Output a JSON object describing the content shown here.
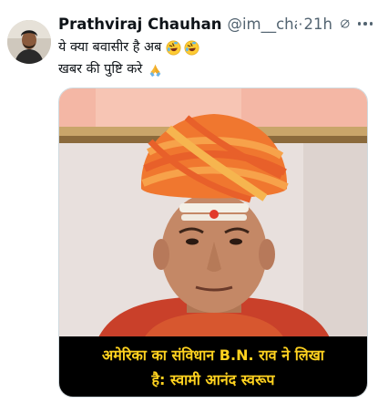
{
  "tweet": {
    "display_name": "Prathviraj Chauhan",
    "handle": "@im__chauh...",
    "separator": "·",
    "time": "21h",
    "text_line1": "ये क्या बवासीर है अब",
    "text_line2": "खबर की पुष्टि करे",
    "emoji_line1": [
      "rolling-on-floor-laughing",
      "rolling-on-floor-laughing"
    ],
    "emoji_line2": [
      "folded-hands"
    ]
  },
  "media": {
    "caption_line1": "अमेरिका का संविधान B.N. राव ने लिखा",
    "caption_line2": "है: स्वामी आनंद स्वरूप"
  },
  "colors": {
    "text": "#0f1419",
    "secondary": "#536471",
    "caption_text": "#ffd21f",
    "caption_bg": "#000000",
    "turban": "#f0772f"
  },
  "icons": [
    "grok-icon",
    "more-icon"
  ]
}
